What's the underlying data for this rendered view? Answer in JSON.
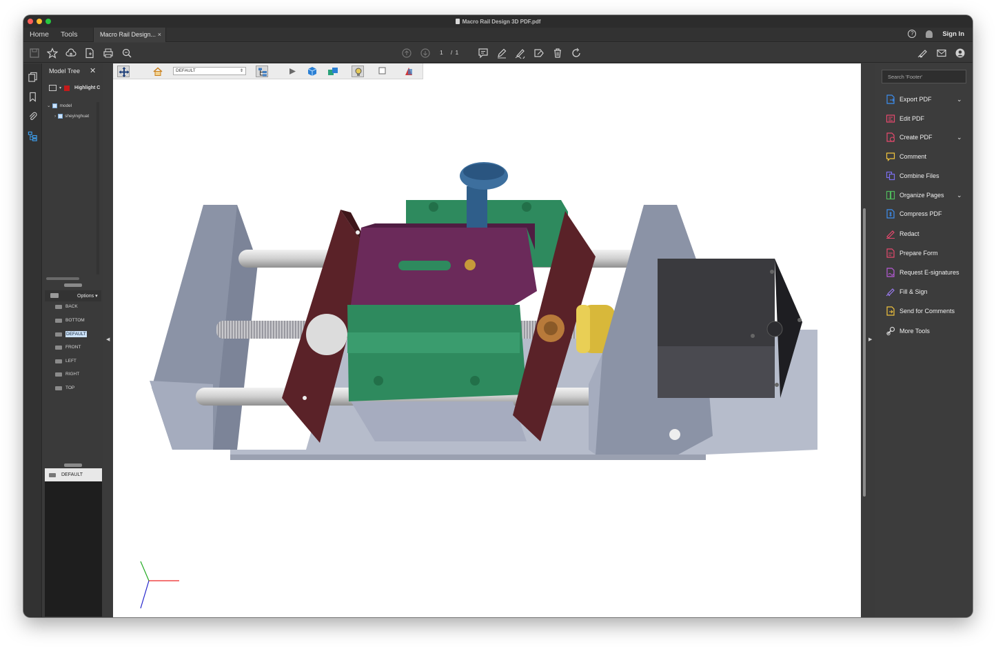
{
  "window": {
    "title": "Macro Rail Design 3D PDF.pdf"
  },
  "menu": {
    "home": "Home",
    "tools": "Tools"
  },
  "tab": {
    "label": "Macro Rail Design...",
    "close": "×"
  },
  "header_right": {
    "help": "?",
    "sign_in": "Sign In"
  },
  "pager": {
    "current": "1",
    "total": "/ 1"
  },
  "model_tree": {
    "title": "Model Tree",
    "highlight_label": "Highlight C",
    "items": [
      {
        "label": "model"
      },
      {
        "label": "sheyinghuat"
      }
    ]
  },
  "views": {
    "options_label": "Options",
    "items": [
      "BACK",
      "BOTTOM",
      "DEFAULT",
      "FRONT",
      "LEFT",
      "RIGHT",
      "TOP"
    ],
    "selected": "DEFAULT",
    "current_view": "DEFAULT"
  },
  "toolbar3d": {
    "view_select": "DEFAULT"
  },
  "right_pane": {
    "search_placeholder": "Search 'Footer'",
    "tools": [
      {
        "label": "Export PDF",
        "icon": "export-pdf-icon",
        "color": "#3d8ef0",
        "expand": true
      },
      {
        "label": "Edit PDF",
        "icon": "edit-pdf-icon",
        "color": "#e8496e",
        "expand": false
      },
      {
        "label": "Create PDF",
        "icon": "create-pdf-icon",
        "color": "#e8496e",
        "expand": true
      },
      {
        "label": "Comment",
        "icon": "comment-icon",
        "color": "#f3c43d",
        "expand": false
      },
      {
        "label": "Combine Files",
        "icon": "combine-files-icon",
        "color": "#7d6ff0",
        "expand": false
      },
      {
        "label": "Organize Pages",
        "icon": "organize-pages-icon",
        "color": "#4fba5c",
        "expand": true
      },
      {
        "label": "Compress PDF",
        "icon": "compress-pdf-icon",
        "color": "#3d8ef0",
        "expand": false
      },
      {
        "label": "Redact",
        "icon": "redact-icon",
        "color": "#e8496e",
        "expand": false
      },
      {
        "label": "Prepare Form",
        "icon": "prepare-form-icon",
        "color": "#e8496e",
        "expand": false
      },
      {
        "label": "Request E-signatures",
        "icon": "request-esignatures-icon",
        "color": "#b85ad8",
        "expand": false
      },
      {
        "label": "Fill & Sign",
        "icon": "fill-sign-icon",
        "color": "#9b7cf0",
        "expand": false
      },
      {
        "label": "Send for Comments",
        "icon": "send-for-comments-icon",
        "color": "#f3c43d",
        "expand": false
      },
      {
        "label": "More Tools",
        "icon": "more-tools-icon",
        "color": "#d8d8d8",
        "expand": false
      }
    ]
  },
  "colors": {
    "window_bg": "#3b3b3b",
    "accent": "#3d8ef0",
    "part_green": "#2e8a5e",
    "part_purple": "#6b2a5a",
    "part_maroon": "#5a2228",
    "part_steel": "#a6acbf",
    "part_motor": "#3a3a3e",
    "part_gold": "#d8b83a",
    "part_blue": "#2f5e8a"
  }
}
